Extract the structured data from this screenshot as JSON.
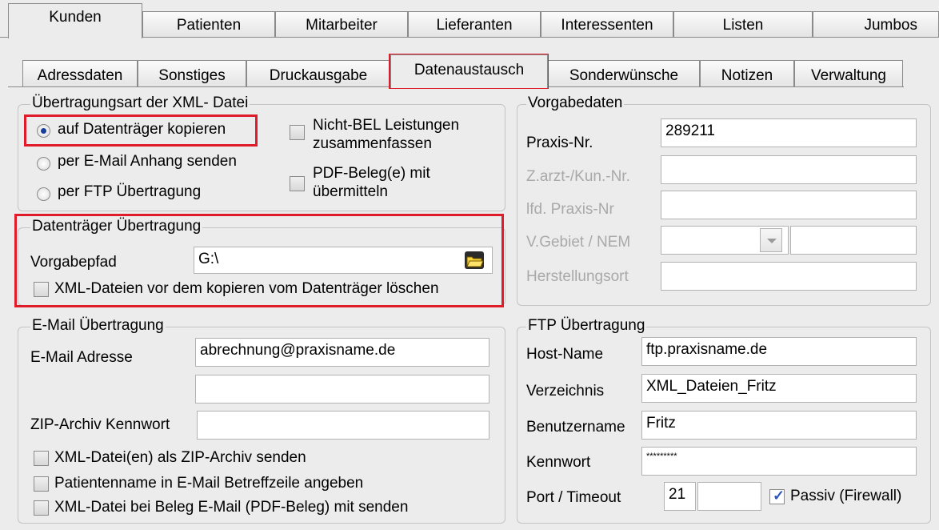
{
  "main_tabs": [
    "Kunden",
    "Patienten",
    "Mitarbeiter",
    "Lieferanten",
    "Interessenten",
    "Listen",
    "Jumbos"
  ],
  "sub_tabs": [
    "Adressdaten",
    "Sonstiges",
    "Druckausgabe",
    "Datenaustausch",
    "Sonderwünsche",
    "Notizen",
    "Verwaltung"
  ],
  "active_main_tab": "Kunden",
  "active_sub_tab": "Datenaustausch",
  "transfer": {
    "legend": "Übertragungsart der XML- Datei",
    "options": [
      "auf Datenträger kopieren",
      "per E-Mail Anhang senden",
      "per FTP Übertragung"
    ],
    "selected": "auf Datenträger kopieren",
    "check_nonbel": "Nicht-BEL Leistungen zusammenfassen",
    "check_nonbel_l1": "Nicht-BEL Leistungen",
    "check_nonbel_l2": "zusammenfassen",
    "check_pdf_l1": "PDF-Beleg(e) mit",
    "check_pdf_l2": "übermitteln"
  },
  "media": {
    "legend": "Datenträger Übertragung",
    "path_label": "Vorgabepfad",
    "path_value": "G:\\",
    "delete_check": "XML-Dateien vor dem kopieren vom Datenträger löschen"
  },
  "defaults": {
    "legend": "Vorgabedaten",
    "praxis_label": "Praxis-Nr.",
    "praxis_value": "289211",
    "zarzt_label": "Z.arzt-/Kun.-Nr.",
    "lfd_label": "lfd. Praxis-Nr",
    "gebiet_label": "V.Gebiet / NEM",
    "herstellung_label": "Herstellungsort"
  },
  "email": {
    "legend": "E-Mail Übertragung",
    "address_label": "E-Mail Adresse",
    "address_value": "abrechnung@praxisname.de",
    "zip_label": "ZIP-Archiv Kennwort",
    "check_zip": "XML-Datei(en) als ZIP-Archiv senden",
    "check_patient": "Patientenname in E-Mail Betreffzeile angeben",
    "check_beleg": "XML-Datei bei Beleg E-Mail (PDF-Beleg) mit senden"
  },
  "ftp": {
    "legend": "FTP Übertragung",
    "host_label": "Host-Name",
    "host_value": "ftp.praxisname.de",
    "dir_label": "Verzeichnis",
    "dir_value": "XML_Dateien_Fritz",
    "user_label": "Benutzername",
    "user_value": "Fritz",
    "pass_label": "Kennwort",
    "pass_value": "*********",
    "port_label": "Port / Timeout",
    "port_value": "21",
    "passive_label": "Passiv (Firewall)",
    "passive_checked": true
  },
  "colors": {
    "highlight": "#e01b2a",
    "accent": "#1a3f9a"
  },
  "icons": {
    "browse": "folder-icon"
  }
}
